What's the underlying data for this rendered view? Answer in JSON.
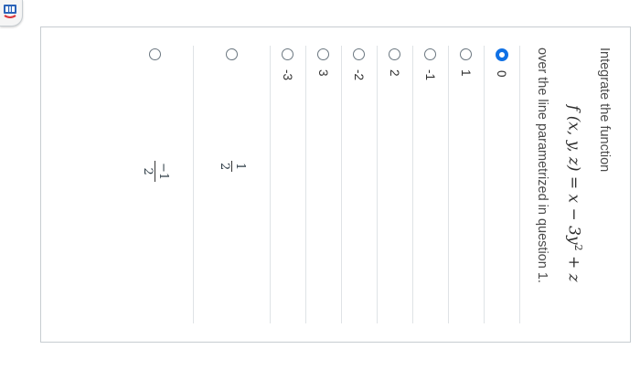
{
  "app_icon": "quiz-app-icon",
  "question": {
    "prompt_before": "Integrate the function",
    "formula": {
      "lhs": "f (x, y, z) = x − 3y",
      "exponent": "2",
      "rhs": " + z"
    },
    "prompt_after": "over the line parametrized in question 1."
  },
  "answers": [
    {
      "label": "0",
      "selected": true
    },
    {
      "label": "1",
      "selected": false
    },
    {
      "label": "-1",
      "selected": false
    },
    {
      "label": "2",
      "selected": false
    },
    {
      "label": "-2",
      "selected": false
    },
    {
      "label": "3",
      "selected": false
    },
    {
      "label": "-3",
      "selected": false
    },
    {
      "numerator": "1",
      "denominator": "2",
      "selected": false
    },
    {
      "numerator": "−1",
      "denominator": "2",
      "selected": false
    }
  ],
  "colors": {
    "selected_radio": "#1071e5",
    "border": "#c7cdd1"
  }
}
